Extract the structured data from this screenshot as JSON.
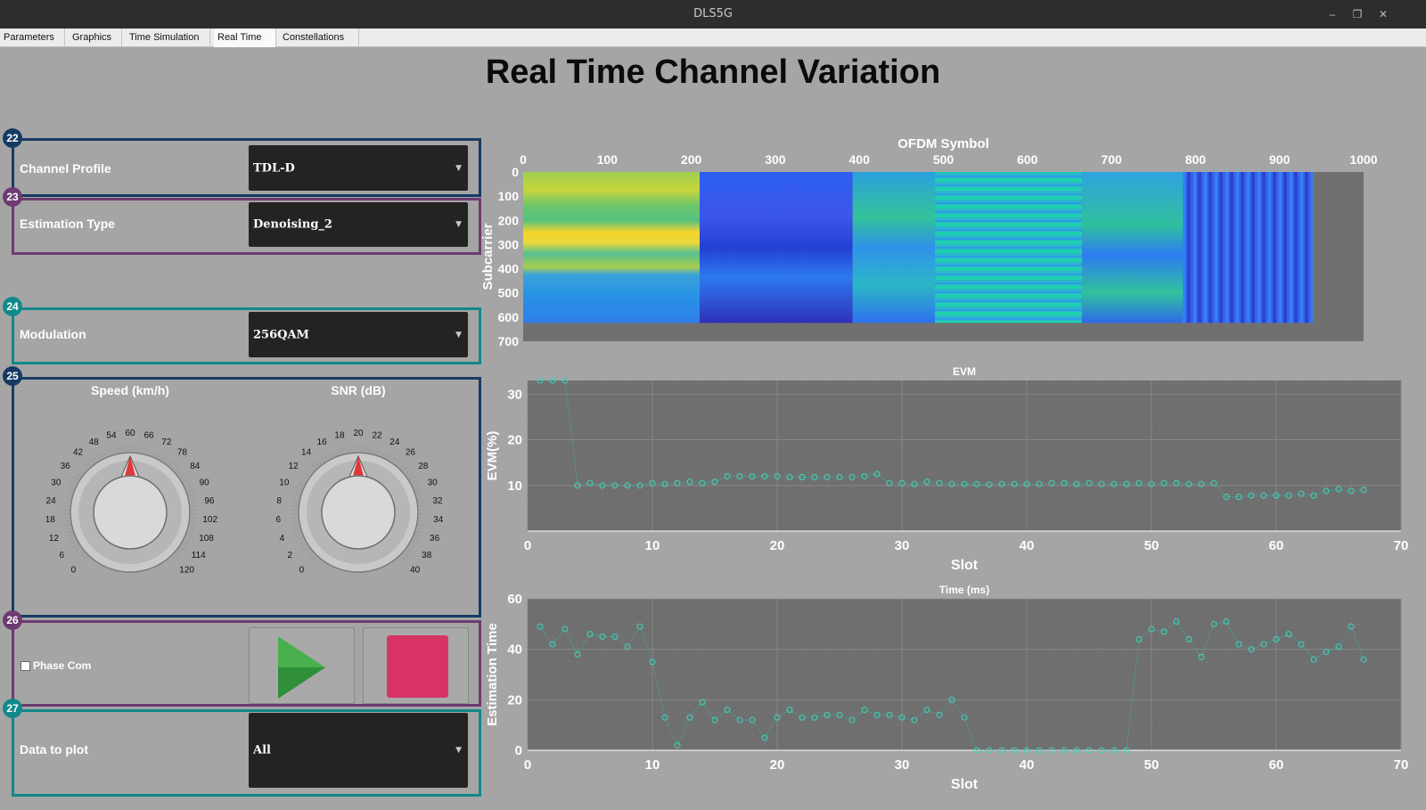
{
  "window": {
    "title": "DLS5G",
    "minimize": "–",
    "restore": "❐",
    "close": "✕"
  },
  "tabs": [
    {
      "label": "Parameters",
      "active": false
    },
    {
      "label": "Graphics",
      "active": false
    },
    {
      "label": "Time Simulation",
      "active": false
    },
    {
      "label": "Real Time",
      "active": true
    },
    {
      "label": "Constellations",
      "active": false
    }
  ],
  "page_title": "Real Time Channel Variation",
  "panels": {
    "channel_profile": {
      "badge": "22",
      "label": "Channel Profile",
      "value": "TDL-D",
      "color": "#173a63"
    },
    "estimation_type": {
      "badge": "23",
      "label": "Estimation Type",
      "value": "Denoising_2",
      "color": "#6d3b72"
    },
    "modulation": {
      "badge": "24",
      "label": "Modulation",
      "value": "256QAM",
      "color": "#11898a"
    },
    "knobs": {
      "badge": "25",
      "color": "#173a63",
      "speed": {
        "title": "Speed (km/h)",
        "value": 60,
        "min": 0,
        "max": 120,
        "labels": [
          "0",
          "6",
          "12",
          "18",
          "24",
          "30",
          "36",
          "42",
          "48",
          "54",
          "60",
          "66",
          "72",
          "78",
          "84",
          "90",
          "96",
          "102",
          "108",
          "114",
          "120"
        ]
      },
      "snr": {
        "title": "SNR (dB)",
        "value": 20,
        "min": 0,
        "max": 40,
        "labels": [
          "0",
          "2",
          "4",
          "6",
          "8",
          "10",
          "12",
          "14",
          "16",
          "18",
          "20",
          "22",
          "24",
          "26",
          "28",
          "30",
          "32",
          "34",
          "36",
          "38",
          "40"
        ]
      }
    },
    "controls": {
      "badge": "26",
      "color": "#6d3b72",
      "phase_label": "Phase Com",
      "phase_checked": false
    },
    "data_to_plot": {
      "badge": "27",
      "label": "Data to plot",
      "value": "All",
      "color": "#11898a"
    }
  },
  "chart_data": [
    {
      "type": "heatmap",
      "title": "",
      "xlabel": "OFDM Symbol",
      "ylabel": "Subcarrier",
      "xlim": [
        0,
        1000
      ],
      "ylim": [
        0,
        700
      ],
      "xticks": [
        "0",
        "100",
        "200",
        "300",
        "400",
        "500",
        "600",
        "700",
        "800",
        "900",
        "1000"
      ],
      "yticks": [
        "0",
        "100",
        "200",
        "300",
        "400",
        "500",
        "600",
        "700"
      ],
      "data_extent": {
        "symbols": [
          0,
          940
        ],
        "subcarriers": [
          0,
          624
        ]
      },
      "segments": [
        {
          "start": 0,
          "end": 210,
          "pattern": "yellow-green, bright band near subcarrier 270"
        },
        {
          "start": 210,
          "end": 392,
          "pattern": "dark blue"
        },
        {
          "start": 392,
          "end": 490,
          "pattern": "light blue / cyan"
        },
        {
          "start": 490,
          "end": 665,
          "pattern": "cyan horizontal stripes"
        },
        {
          "start": 665,
          "end": 785,
          "pattern": "cyan / blue mixed"
        },
        {
          "start": 785,
          "end": 940,
          "pattern": "blue vertical stripes"
        }
      ]
    },
    {
      "type": "scatter",
      "title": "EVM",
      "xlabel": "Slot",
      "ylabel": "EVM(%)",
      "xlim": [
        0,
        70
      ],
      "ylim": [
        0,
        33
      ],
      "xticks": [
        "0",
        "10",
        "20",
        "30",
        "40",
        "50",
        "60",
        "70"
      ],
      "yticks": [
        "10",
        "20",
        "30"
      ],
      "grid": true,
      "x": [
        1,
        2,
        3,
        4,
        5,
        6,
        7,
        8,
        9,
        10,
        11,
        12,
        13,
        14,
        15,
        16,
        17,
        18,
        19,
        20,
        21,
        22,
        23,
        24,
        25,
        26,
        27,
        28,
        29,
        30,
        31,
        32,
        33,
        34,
        35,
        36,
        37,
        38,
        39,
        40,
        41,
        42,
        43,
        44,
        45,
        46,
        47,
        48,
        49,
        50,
        51,
        52,
        53,
        54,
        55,
        56,
        57,
        58,
        59,
        60,
        61,
        62,
        63,
        64,
        65,
        66,
        67
      ],
      "y": [
        33,
        33,
        33,
        10,
        10.5,
        10,
        10,
        10,
        10,
        10.5,
        10.3,
        10.5,
        10.8,
        10.5,
        10.8,
        12,
        12,
        12,
        12,
        12,
        11.8,
        11.8,
        11.8,
        11.8,
        11.8,
        11.8,
        12,
        12.5,
        10.5,
        10.5,
        10.3,
        10.8,
        10.5,
        10.3,
        10.3,
        10.3,
        10.2,
        10.3,
        10.3,
        10.3,
        10.3,
        10.5,
        10.5,
        10.3,
        10.5,
        10.3,
        10.3,
        10.3,
        10.5,
        10.3,
        10.5,
        10.5,
        10.3,
        10.3,
        10.5,
        7.5,
        7.5,
        7.8,
        7.8,
        7.8,
        7.8,
        8.2,
        7.8,
        8.8,
        9.2,
        8.8,
        9,
        8.8
      ]
    },
    {
      "type": "scatter",
      "title": "Time (ms)",
      "xlabel": "Slot",
      "ylabel": "Estimation Time",
      "xlim": [
        0,
        70
      ],
      "ylim": [
        0,
        60
      ],
      "xticks": [
        "0",
        "10",
        "20",
        "30",
        "40",
        "50",
        "60",
        "70"
      ],
      "yticks": [
        "0",
        "20",
        "40",
        "60"
      ],
      "grid": true,
      "x": [
        1,
        2,
        3,
        4,
        5,
        6,
        7,
        8,
        9,
        10,
        11,
        12,
        13,
        14,
        15,
        16,
        17,
        18,
        19,
        20,
        21,
        22,
        23,
        24,
        25,
        26,
        27,
        28,
        29,
        30,
        31,
        32,
        33,
        34,
        35,
        36,
        37,
        38,
        39,
        40,
        41,
        42,
        43,
        44,
        45,
        46,
        47,
        48,
        49,
        50,
        51,
        52,
        53,
        54,
        55,
        56,
        57,
        58,
        59,
        60,
        61,
        62,
        63,
        64,
        65,
        66,
        67
      ],
      "y": [
        49,
        42,
        48,
        38,
        46,
        45,
        45,
        41,
        49,
        35,
        13,
        2,
        13,
        19,
        12,
        16,
        12,
        12,
        5,
        13,
        16,
        13,
        13,
        14,
        14,
        12,
        16,
        14,
        14,
        13,
        12,
        16,
        14,
        20,
        13,
        0,
        0,
        0,
        0,
        0,
        0,
        0,
        0,
        0,
        0,
        0,
        0,
        0,
        44,
        48,
        47,
        51,
        44,
        37,
        50,
        51,
        42,
        40,
        42,
        44,
        46,
        42,
        36,
        39,
        41,
        49,
        36,
        37
      ]
    }
  ]
}
